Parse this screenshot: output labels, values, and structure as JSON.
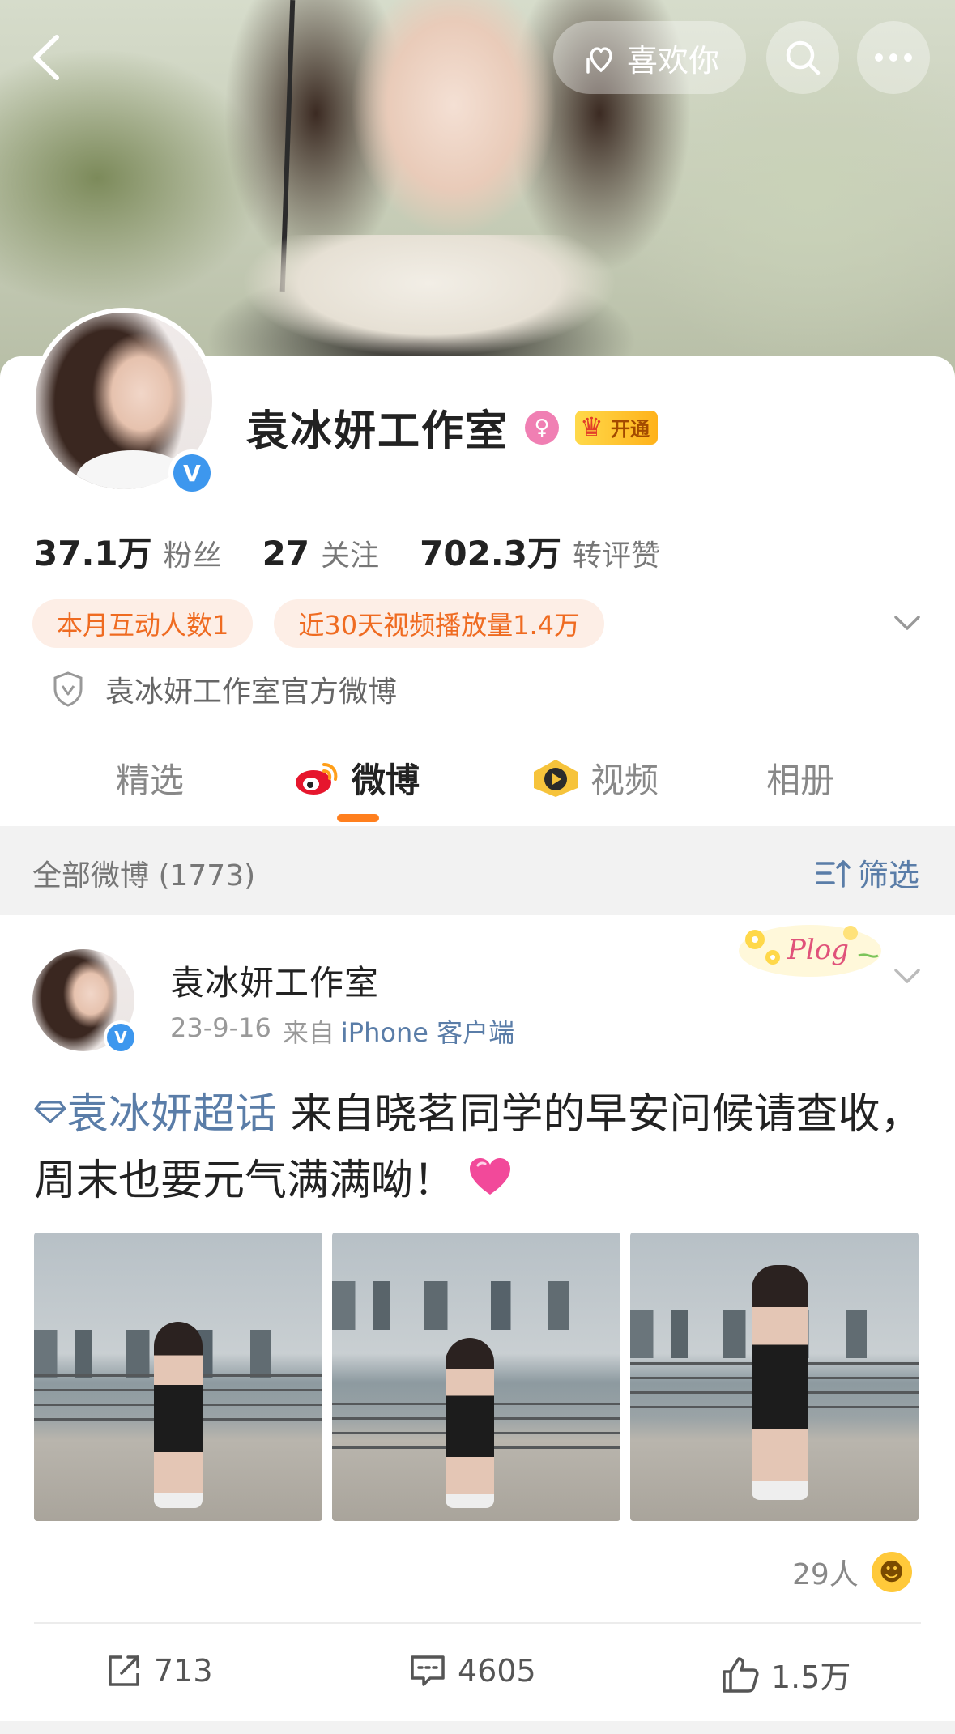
{
  "header": {
    "like_label": "喜欢你",
    "icons": {
      "back": "chevron-left-icon",
      "like": "hand-heart-icon",
      "search": "search-icon",
      "more": "more-dots-icon"
    }
  },
  "profile": {
    "name": "袁冰妍工作室",
    "gender_symbol": "♀",
    "vip_label": "开通",
    "verified_symbol": "V",
    "stats": [
      {
        "num": "37.1万",
        "label": "粉丝"
      },
      {
        "num": "27",
        "label": "关注"
      },
      {
        "num": "702.3万",
        "label": "转评赞"
      }
    ],
    "pills": [
      "本月互动人数1",
      "近30天视频播放量1.4万"
    ],
    "official_desc": "袁冰妍工作室官方微博"
  },
  "tabs": [
    {
      "label": "精选",
      "active": false
    },
    {
      "label": "微博",
      "active": true
    },
    {
      "label": "视频",
      "active": false
    },
    {
      "label": "相册",
      "active": false
    }
  ],
  "filter_bar": {
    "count_text": "全部微博 (1773)",
    "filter_label": "筛选"
  },
  "post": {
    "author": "袁冰妍工作室",
    "date": "23-9-16",
    "from_prefix": "来自",
    "source": "iPhone 客户端",
    "sticker_text": "Plog",
    "topic": "袁冰妍超话",
    "text": " 来自晓茗同学的早安问候请查收，周末也要元气满满呦！",
    "reaction_count": "29人",
    "actions": {
      "repost": "713",
      "comment": "4605",
      "like": "1.5万"
    }
  },
  "colors": {
    "accent_orange": "#ff7f1e",
    "link_blue": "#5a7da8",
    "pill_bg": "#fdeee6",
    "pill_text": "#ef6b21",
    "verify_blue": "#3d97ee"
  }
}
